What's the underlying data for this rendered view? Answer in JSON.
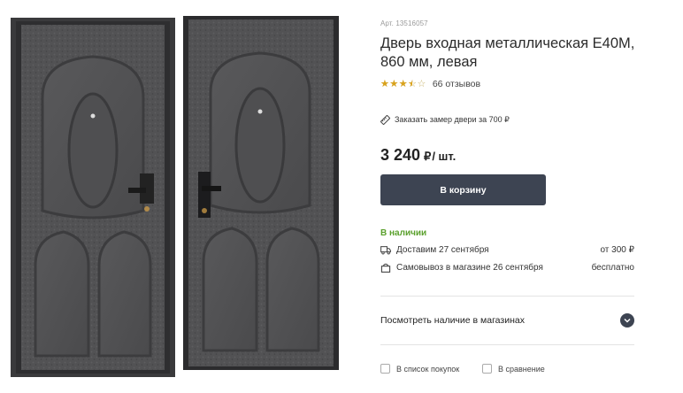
{
  "product": {
    "sku": "Арт. 13516057",
    "title": "Дверь входная металлическая Е40М, 860 мм, левая",
    "rating": 3.5,
    "stars_empty": "☆☆☆☆☆",
    "stars_full": "★★★★★",
    "reviews": "66 отзывов",
    "measure_link": "Заказать замер двери за 700 ₽",
    "price": "3 240",
    "currency": "₽",
    "unit": "/ шт.",
    "cart_button": "В корзину"
  },
  "availability": {
    "status": "В наличии",
    "delivery_label": "Доставим 27 сентября",
    "delivery_price": "от 300 ₽",
    "pickup_label": "Самовывоз в магазине 26 сентября",
    "pickup_price": "бесплатно",
    "stores_link": "Посмотреть наличие в магазинах"
  },
  "actions": {
    "shopping_list": "В список покупок",
    "compare": "В сравнение"
  },
  "colors": {
    "button_bg": "#3d4452",
    "in_stock": "#5aa02c",
    "star": "#d9a21b",
    "door_metal": "#4d4d4f"
  },
  "icons": {
    "measure": "ruler-icon",
    "delivery": "truck-icon",
    "pickup": "bag-icon",
    "stores": "chevron-down-icon"
  }
}
